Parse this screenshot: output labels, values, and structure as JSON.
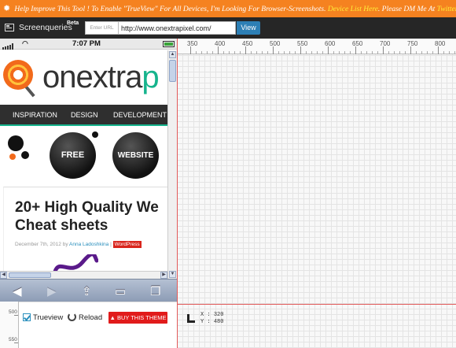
{
  "banner": {
    "text_prefix": "Help Improve This Tool ! To Enable \"TrueView\" For All Devices, I'm Looking For Browser-Screenshots. ",
    "link": "Device List Here",
    "text_suffix": ". Please DM Me At ",
    "link2": "Twitter"
  },
  "toolbar": {
    "title": "Screenqueries",
    "beta": "Beta",
    "url_label": "Enter URL",
    "url_value": "http://www.onextrapixel.com/",
    "view_label": "View"
  },
  "device": {
    "time": "7:07 PM",
    "site": {
      "logo_main": "onextra",
      "logo_accent": "p",
      "nav": [
        "INSPIRATION",
        "DESIGN",
        "DEVELOPMENT"
      ],
      "badge_free": "FREE",
      "badge_website": "WEBSITE",
      "article_title_line1": "20+ High Quality We",
      "article_title_line2": "Cheat sheets",
      "article_date": "December 7th, 2012 by ",
      "article_author": "Anna Ladoshkina",
      "article_tag": "WordPress"
    },
    "safari_buttons": [
      "back",
      "forward",
      "share",
      "bookmarks",
      "tabs"
    ]
  },
  "ruler": {
    "top_labels": [
      "350",
      "400",
      "450",
      "500",
      "550",
      "600",
      "650",
      "700",
      "750",
      "800"
    ],
    "left_labels": [
      "500",
      "550"
    ]
  },
  "coords": {
    "x_label": "X",
    "x_value": "320",
    "y_label": "Y",
    "y_value": "480"
  },
  "controls": {
    "trueview": "Trueview",
    "trueview_checked": true,
    "reload": "Reload",
    "buy_theme": "BUY THIS THEME"
  },
  "colors": {
    "banner_bg": "#f58220",
    "banner_highlight": "#ffef3a",
    "toolbar_bg": "#262626",
    "view_button": "#2d7fb5",
    "guide_line": "#e25a5a",
    "buy_button": "#e11b1b",
    "site_accent": "#16b48d"
  }
}
